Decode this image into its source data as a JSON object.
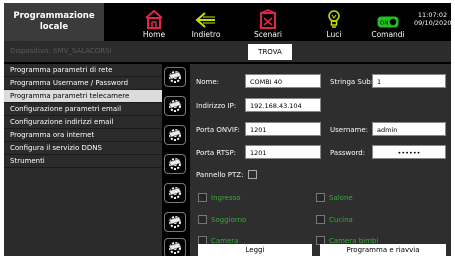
{
  "header": {
    "title": "Programmazione\nlocale",
    "datetime_time": "11:07:02",
    "datetime_date": "09/10/2020",
    "nav": {
      "home": {
        "label": "Home",
        "icon": "home-icon",
        "color": "#e0244a"
      },
      "back": {
        "label": "Indietro",
        "icon": "arrow-left-icon",
        "color": "#c8e000"
      },
      "scenes": {
        "label": "Scenari",
        "icon": "scene-icon",
        "color": "#e0244a"
      },
      "lights": {
        "label": "Luci",
        "icon": "lightbulb-icon",
        "color": "#c8e000"
      },
      "commands": {
        "label": "Comandi",
        "icon": "toggle-on-icon",
        "color": "#22c022",
        "toggle_text": "ON"
      }
    }
  },
  "device_bar": {
    "device_label": "Dispositivo: SMV_SALACORSI",
    "find_button": "TROVA"
  },
  "menu": {
    "items": [
      {
        "label": "Programma parametri di rete",
        "selected": false
      },
      {
        "label": "Programma Username / Password",
        "selected": false
      },
      {
        "label": "Programma parametri telecamere",
        "selected": true
      },
      {
        "label": "Configurazione parametri email",
        "selected": false
      },
      {
        "label": "Configurazione indirizzi email",
        "selected": false
      },
      {
        "label": "Programma ora internet",
        "selected": false
      },
      {
        "label": "Configura il servizio DDNS",
        "selected": false
      },
      {
        "label": "Strumenti",
        "selected": false
      }
    ]
  },
  "form": {
    "name_label": "Nome:",
    "name_value": "COMBI 40",
    "substring_label": "Stringa Sub:",
    "substring_value": "1",
    "ip_label": "Indirizzo IP:",
    "ip_value": "192.168.43.104",
    "onvif_label": "Porta ONVIF:",
    "onvif_value": "1201",
    "username_label": "Username:",
    "username_value": "admin",
    "rtsp_label": "Porta RTSP:",
    "rtsp_value": "1201",
    "password_label": "Password:",
    "password_value": "••••••",
    "ptz_label": "Pannello PTZ:",
    "rooms": [
      {
        "label": "Ingresso"
      },
      {
        "label": "Salone"
      },
      {
        "label": "Soggiorno"
      },
      {
        "label": "Cucina"
      },
      {
        "label": "Camera"
      },
      {
        "label": "Camera bimbi"
      }
    ],
    "read_button": "Leggi",
    "program_button": "Programma e riavvia"
  },
  "colors": {
    "room_text": "#3aa83a",
    "selected_menu_bg": "#dcdcdc"
  }
}
